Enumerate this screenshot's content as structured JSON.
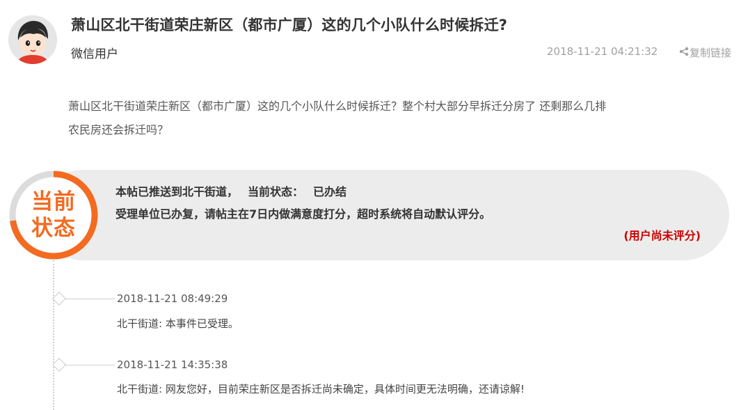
{
  "post": {
    "title": "萧山区北干街道荣庄新区（都市广厦）这的几个小队什么时候拆迁?",
    "author": "微信用户",
    "timestamp": "2018-11-21 04:21:32",
    "copy_link_label": "复制链接",
    "body_line1": "萧山区北干街道荣庄新区（都市广厦）这的几个小队什么时候拆迁？整个村大部分早拆迁分房了 还剩那么几排",
    "body_line2": "农民房还会拆迁吗？"
  },
  "status": {
    "badge_line1": "当前",
    "badge_line2": "状态",
    "pushed_to": "本帖已推送到北干街道，",
    "current_label": "当前状态：",
    "current_value": "已办结",
    "notice": "受理单位已办复，请帖主在7日内做满意度打分，超时系统将自动默认评分。",
    "rating": "(用户尚未评分)",
    "colors": {
      "accent": "#f36b21",
      "rating": "#cc0000",
      "banner_bg": "#ececec"
    }
  },
  "timeline": [
    {
      "time": "2018-11-21 08:49:29",
      "text": "北干街道: 本事件已受理。"
    },
    {
      "time": "2018-11-21 14:35:38",
      "text": "北干街道: 网友您好，目前荣庄新区是否拆迁尚未确定，具体时间更无法明确，还请谅解!"
    }
  ],
  "icons": {
    "avatar": "cartoon-avatar",
    "share": "share-icon"
  }
}
